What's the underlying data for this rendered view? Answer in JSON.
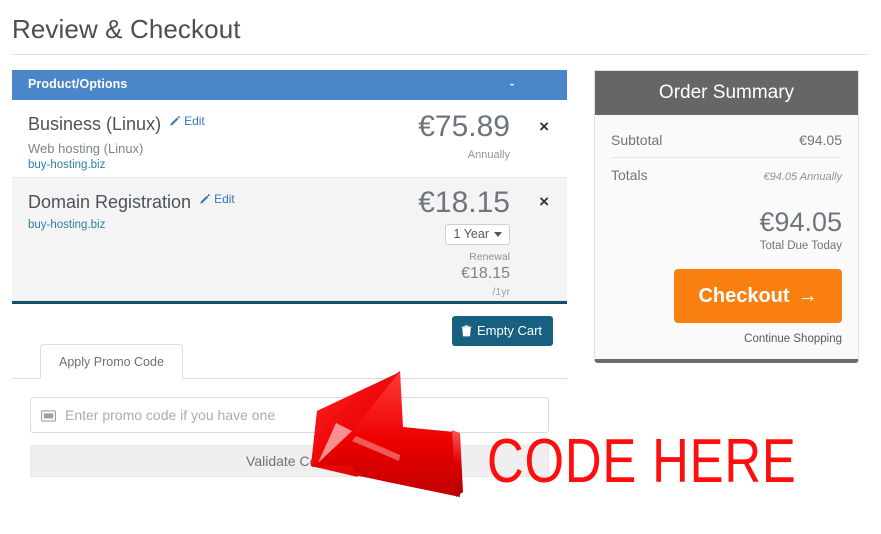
{
  "page": {
    "title": "Review & Checkout"
  },
  "cart": {
    "header": {
      "product_col": "Product/Options",
      "price_col": "-"
    },
    "items": [
      {
        "name": "Business (Linux)",
        "edit_label": "Edit",
        "subtitle": "Web hosting (Linux)",
        "domain": "buy-hosting.biz",
        "price": "€75.89",
        "cycle": "Annually",
        "remove_label": "×"
      },
      {
        "name": "Domain Registration",
        "edit_label": "Edit",
        "subtitle": "",
        "domain": "buy-hosting.biz",
        "price": "€18.15",
        "term_selected": "1 Year",
        "renewal_label": "Renewal",
        "renewal_price": "€18.15",
        "renewal_period": "/1yr",
        "remove_label": "×"
      }
    ],
    "empty_cart_label": "Empty Cart"
  },
  "promo": {
    "tab_label": "Apply Promo Code",
    "input_value": "",
    "input_placeholder": "Enter promo code if you have one",
    "validate_label": "Validate Code"
  },
  "summary": {
    "title": "Order Summary",
    "rows": [
      {
        "label": "Subtotal",
        "value": "€94.05"
      },
      {
        "label": "Totals",
        "value": "€94.05 Annually"
      }
    ],
    "total_amount": "€94.05",
    "total_label": "Total Due Today",
    "checkout_label": "Checkout",
    "checkout_arrow": "→",
    "continue_label": "Continue Shopping"
  },
  "annotation": {
    "text": "CODE HERE",
    "color": "#ff0e0e"
  },
  "colors": {
    "cart_header_blue": "#4a86c8",
    "cart_bottom_rule": "#14506b",
    "empty_cart_blue": "#17607f",
    "summary_header_grey": "#666666",
    "checkout_orange": "#f98010",
    "edit_link_blue": "#337ab7",
    "annotation_red": "#ff0e0e"
  }
}
